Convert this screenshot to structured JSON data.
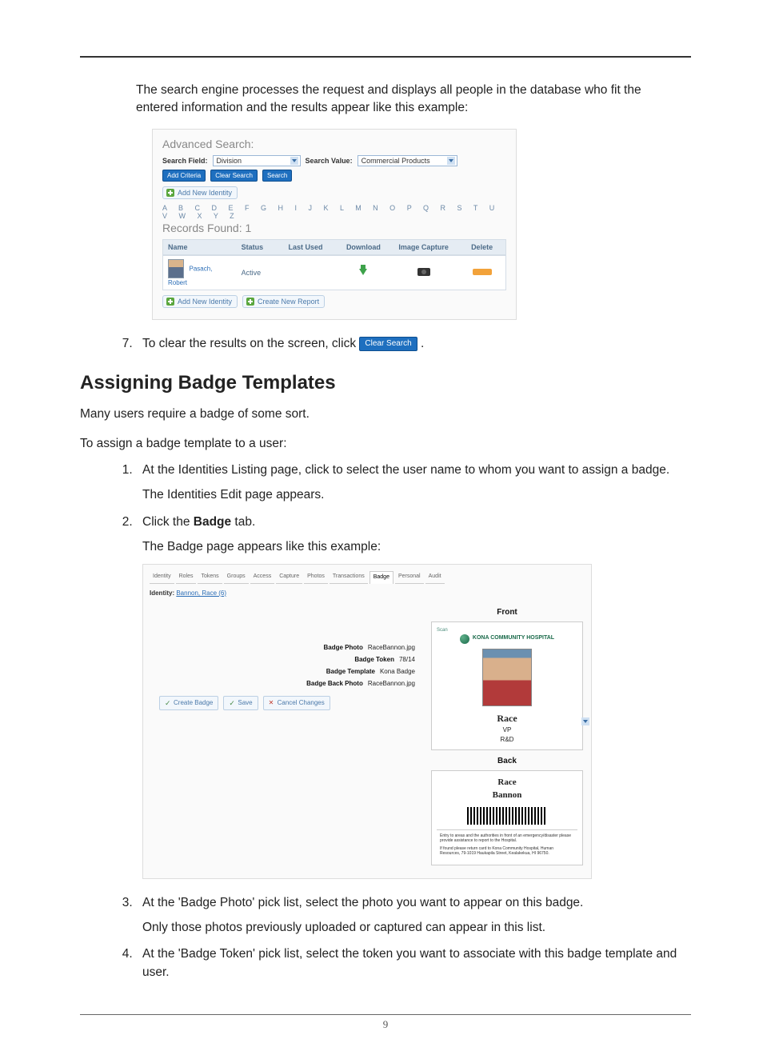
{
  "intro_paragraph": "The search engine processes the request and displays all people in the database who fit the entered information and the results appear like this example:",
  "figure1": {
    "title": "Advanced Search:",
    "search_field_label": "Search Field:",
    "search_field_value": "Division",
    "search_value_label": "Search Value:",
    "search_value_value": "Commercial Products",
    "add_criteria_btn": "Add Criteria",
    "clear_search_btn": "Clear Search",
    "search_btn": "Search",
    "add_new_identity_btn": "Add New Identity",
    "letters": "A B C D E F G H I J K L M N O P Q R S T U V W X Y Z",
    "records_found": "Records Found: 1",
    "columns": {
      "name": "Name",
      "status": "Status",
      "last_used": "Last Used",
      "download": "Download",
      "image_capture": "Image Capture",
      "delete": "Delete"
    },
    "row": {
      "name": "Pasach, Robert",
      "status": "Active"
    },
    "create_new_report_btn": "Create New Report"
  },
  "step7_pre": "To clear the results on the screen, click ",
  "step7_btn": "Clear Search",
  "step7_post": " .",
  "heading": "Assigning Badge Templates",
  "para1": "Many users require a badge of some sort.",
  "para2": "To assign a badge template to a user:",
  "step1": "At the Identities Listing page, click to select the user name to whom you want to assign a badge.",
  "step1_sub": "The Identities Edit page appears.",
  "step2_pre": "Click the ",
  "step2_bold": "Badge",
  "step2_post": " tab.",
  "step2_sub": "The Badge page appears like this example:",
  "figure2": {
    "tabs": [
      "Identity",
      "Roles",
      "Tokens",
      "Groups",
      "Access",
      "Capture",
      "Photos",
      "Transactions",
      "Badge",
      "Personal",
      "Audit"
    ],
    "active_tab_index": 8,
    "identity_label": "Identity: ",
    "identity_value": "Bannon, Race  (6)",
    "badge_photo_label": "Badge Photo",
    "badge_photo_value": "RaceBannon.jpg",
    "badge_token_label": "Badge Token",
    "badge_token_value": "78/14",
    "badge_template_label": "Badge Template",
    "badge_template_value": "Kona Badge",
    "badge_back_photo_label": "Badge Back Photo",
    "badge_back_photo_value": "RaceBannon.jpg",
    "create_badge_btn": "Create Badge",
    "save_btn": "Save",
    "cancel_btn": "Cancel Changes",
    "front_label": "Front",
    "back_label": "Back",
    "hospital_name": "KONA COMMUNITY HOSPITAL",
    "scan_label": "Scan",
    "person_first": "Race",
    "person_role1": "VP",
    "person_role2": "R&D",
    "back_name1": "Race",
    "back_name2": "Bannon",
    "fine_print1": "Entry to areas and the authorities in front of an emergency/disaster please provide assistance to report to the Hospital.",
    "fine_print2": "If found please return card to Kona Community Hospital, Human Resources, 79-1019 Haukapila Street, Kealakekua, HI 96750."
  },
  "step3": "At the 'Badge Photo' pick list, select the photo you want to appear on this badge.",
  "step3_sub": "Only those photos previously uploaded or captured can appear in this list.",
  "step4": "At the 'Badge Token' pick list, select the token you want to associate with this badge template and user.",
  "page_number": "9"
}
